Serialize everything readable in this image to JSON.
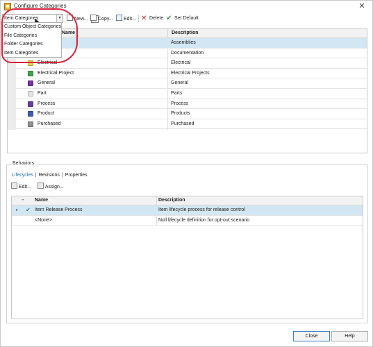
{
  "window": {
    "title": "Configure Categories",
    "close_glyph": "✕"
  },
  "toolbar": {
    "combo_value": "Item Categories",
    "combo_arrow": "▾",
    "new_label": "New...",
    "copy_label": "Copy...",
    "edit_label": "Edit...",
    "delete_label": "Delete",
    "set_default_label": "Set Default"
  },
  "dropdown": {
    "options": [
      "Custom Object Categories",
      "File Categories",
      "Folder Categories",
      "Item Categories"
    ]
  },
  "categories_grid": {
    "headers": {
      "name": "Name",
      "description": "Description"
    },
    "rows": [
      {
        "name": "",
        "description": "Assemblies",
        "color": "#ffffff",
        "selected": true
      },
      {
        "name": "",
        "description": "Documentation",
        "color": "#ffffff",
        "selected": false
      },
      {
        "name": "Electrical",
        "description": "Electrical",
        "color": "#f2d23a",
        "selected": false
      },
      {
        "name": "Electrical Project",
        "description": "Electrical Projects",
        "color": "#3aa84a",
        "selected": false
      },
      {
        "name": "General",
        "description": "General",
        "color": "#7b2fa8",
        "selected": false
      },
      {
        "name": "Part",
        "description": "Parts",
        "color": "#e6e6e6",
        "selected": false
      },
      {
        "name": "Process",
        "description": "Process",
        "color": "#6a3aa8",
        "selected": false
      },
      {
        "name": "Product",
        "description": "Products",
        "color": "#3a5fb0",
        "selected": false
      },
      {
        "name": "Purchased",
        "description": "Purchased",
        "color": "#8f8f8f",
        "selected": false
      }
    ]
  },
  "behaviors": {
    "group_title": "Behaviors",
    "tabs": [
      "Lifecycles",
      "Revisions",
      "Properties"
    ],
    "tab_separator": "|",
    "edit_label": "Edit...",
    "assign_label": "Assign...",
    "grid": {
      "headers": {
        "name": "Name",
        "description": "Description"
      },
      "rows": [
        {
          "name": "Item Release Process",
          "description": "Item lifecycle process for release control",
          "default": true,
          "selected": true
        },
        {
          "name": "<None>",
          "description": "Null lifecycle definition for opt-out scenario",
          "default": false,
          "selected": false
        }
      ],
      "default_mark": "✔",
      "expand_mark": "▸"
    }
  },
  "footer": {
    "close_label": "Close",
    "help_label": "Help"
  },
  "colors": {
    "accent": "#1f6fb2",
    "highlight_ring": "#d9223a",
    "selected_row": "#d3e6f3"
  }
}
